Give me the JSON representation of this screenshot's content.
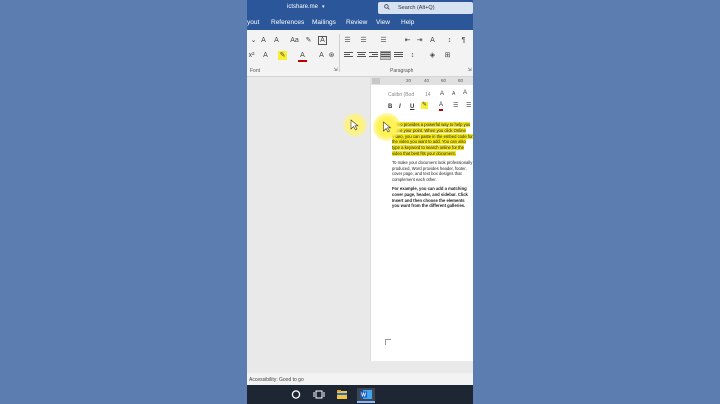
{
  "title_bar": {
    "document_name": "ictshare.me",
    "caret": "▾",
    "search_placeholder": "Search (Alt+Q)"
  },
  "menu": {
    "items": [
      "yout",
      "References",
      "Mailings",
      "Review",
      "View",
      "Help"
    ]
  },
  "ribbon": {
    "font_group_label": "Font",
    "paragraph_group_label": "Paragraph"
  },
  "ruler": {
    "marks": [
      "20",
      "40",
      "60",
      "80"
    ]
  },
  "mini_toolbar": {
    "font": "Calibri (Bod",
    "size": "14",
    "bold": "B",
    "italic": "I",
    "underline": "U"
  },
  "document": {
    "para1_highlighted": "Video provides a powerful way to help you prove your point. When you click Online Video, you can paste in the embed code for the video you want to add. You can also type a keyword to search online for the video that best fits your document.",
    "para2": "To make your document look professionally produced, Word provides header, footer, cover page, and text box designs that complement each other.",
    "para3": "For example, you can add a matching cover page, header, and sidebar. Click Insert and then choose the elements you want from the different galleries."
  },
  "status_bar": {
    "accessibility": "Accessibility: Good to go"
  },
  "colors": {
    "word_blue": "#2b579a",
    "desktop_bg": "#5b7daf",
    "highlight": "#f2e51a"
  }
}
